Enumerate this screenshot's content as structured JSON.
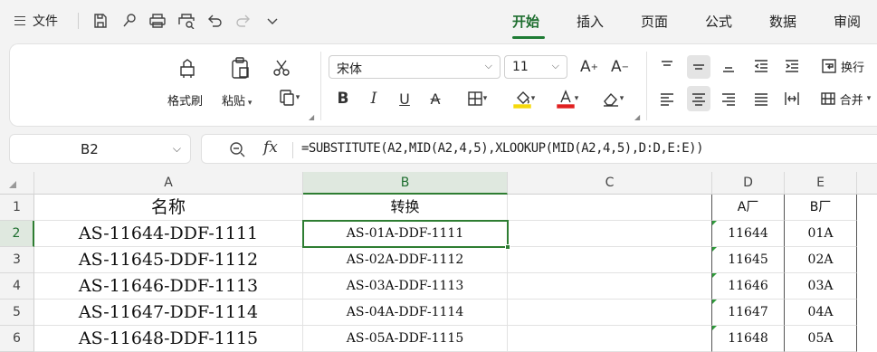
{
  "menu": {
    "file_label": "文件",
    "tabs": [
      {
        "label": "开始",
        "active": true
      },
      {
        "label": "插入",
        "active": false
      },
      {
        "label": "页面",
        "active": false
      },
      {
        "label": "公式",
        "active": false
      },
      {
        "label": "数据",
        "active": false
      },
      {
        "label": "审阅",
        "active": false
      }
    ],
    "quick_icons": [
      "save-icon",
      "format-painter-icon",
      "print-icon",
      "print-preview-icon",
      "undo-icon",
      "redo-icon",
      "more-icon"
    ]
  },
  "ribbon": {
    "format_painter_label": "格式刷",
    "paste_label": "粘贴",
    "font_name": "宋体",
    "font_size": "11",
    "wrap_label": "换行",
    "merge_label": "合并"
  },
  "formula_bar": {
    "cell_ref": "B2",
    "fx_label": "fx",
    "formula": "=SUBSTITUTE(A2,MID(A2,4,5),XLOOKUP(MID(A2,4,5),D:D,E:E))"
  },
  "sheet": {
    "columns": [
      "A",
      "B",
      "C",
      "D",
      "E"
    ],
    "rows": [
      "1",
      "2",
      "3",
      "4",
      "5",
      "6"
    ],
    "header_row": {
      "A": "名称",
      "B": "转换",
      "C": "",
      "D": "A厂",
      "E": "B厂"
    },
    "data": [
      {
        "A": "AS-11644-DDF-1111",
        "B": "AS-01A-DDF-1111",
        "D": "11644",
        "E": "01A"
      },
      {
        "A": "AS-11645-DDF-1112",
        "B": "AS-02A-DDF-1112",
        "D": "11645",
        "E": "02A"
      },
      {
        "A": "AS-11646-DDF-1113",
        "B": "AS-03A-DDF-1113",
        "D": "11646",
        "E": "03A"
      },
      {
        "A": "AS-11647-DDF-1114",
        "B": "AS-04A-DDF-1114",
        "D": "11647",
        "E": "04A"
      },
      {
        "A": "AS-11648-DDF-1115",
        "B": "AS-05A-DDF-1115",
        "D": "11648",
        "E": "05A"
      }
    ],
    "selected_cell": "B2"
  },
  "colors": {
    "accent": "#1e7b34",
    "selection": "#2e7d32"
  }
}
